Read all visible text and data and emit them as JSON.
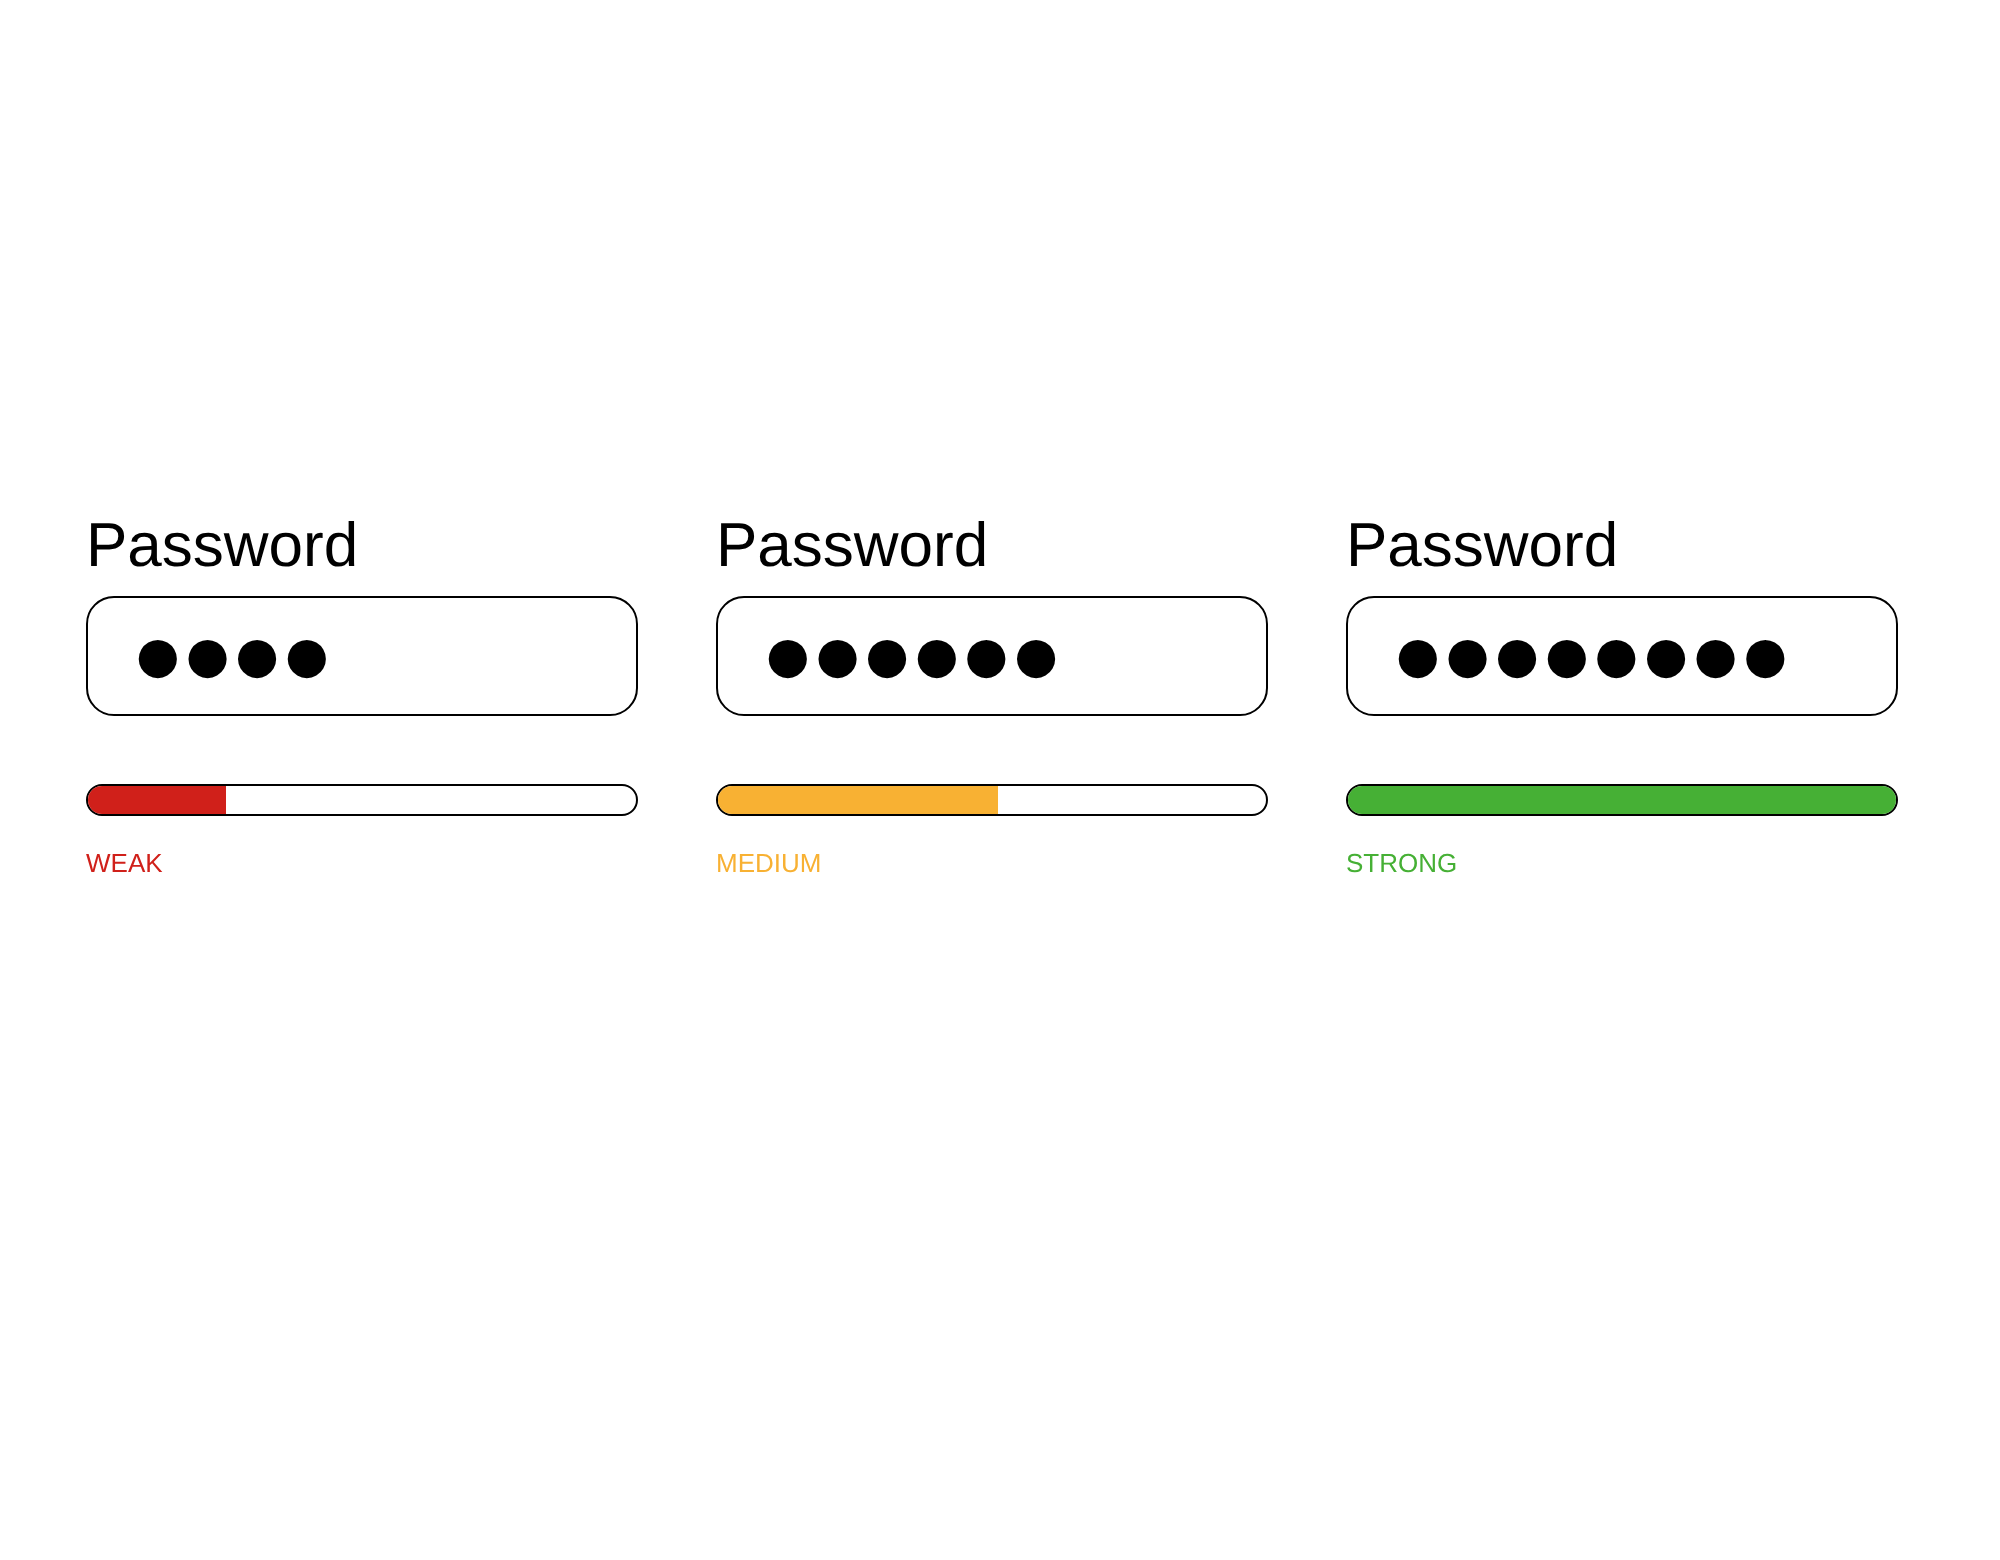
{
  "password_fields": [
    {
      "label": "Password",
      "value": "●●●●",
      "strength": {
        "level": 0.25,
        "color": "#d0201a",
        "text": "WEAK"
      }
    },
    {
      "label": "Password",
      "value": "●●●●●●",
      "strength": {
        "level": 0.51,
        "color": "#f8b133",
        "text": "MEDIUM"
      }
    },
    {
      "label": "Password",
      "value": "●●●●●●●●",
      "strength": {
        "level": 1,
        "color": "#46b035",
        "text": "STRONG"
      }
    }
  ]
}
